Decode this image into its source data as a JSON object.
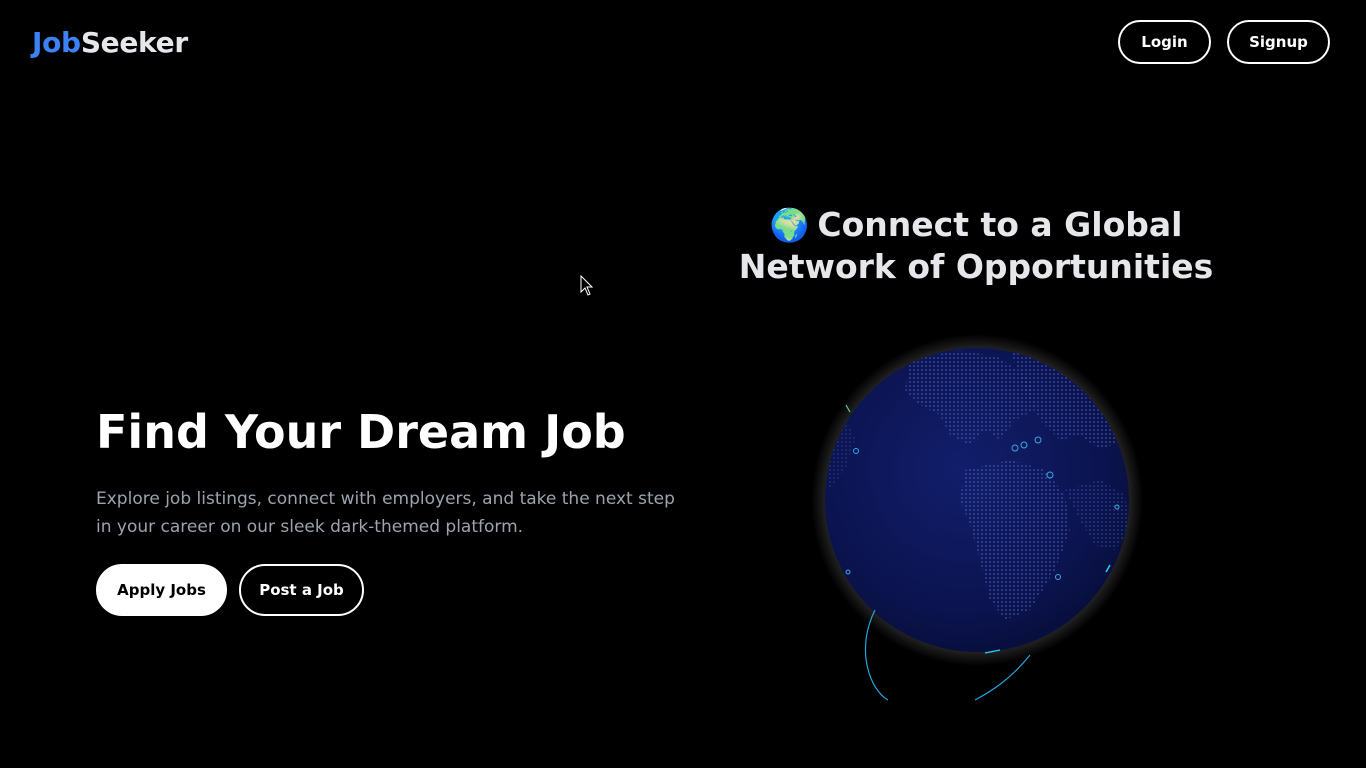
{
  "brand": {
    "part1": "Job",
    "part2": "Seeker",
    "accent_color": "#3b82f6"
  },
  "nav": {
    "login_label": "Login",
    "signup_label": "Signup"
  },
  "hero": {
    "title": "Find Your Dream Job",
    "description": "Explore job listings, connect with employers, and take the next step in your career on our sleek dark-themed platform.",
    "apply_label": "Apply Jobs",
    "post_label": "Post a Job"
  },
  "globe_section": {
    "emoji": "🌍",
    "heading": "Connect to a Global Network of Opportunities",
    "globe_color": "#0b1450",
    "arc_color": "#22a6e0"
  },
  "icons": {
    "globe": "earth-globe-icon",
    "cursor": "mouse-pointer-icon"
  }
}
